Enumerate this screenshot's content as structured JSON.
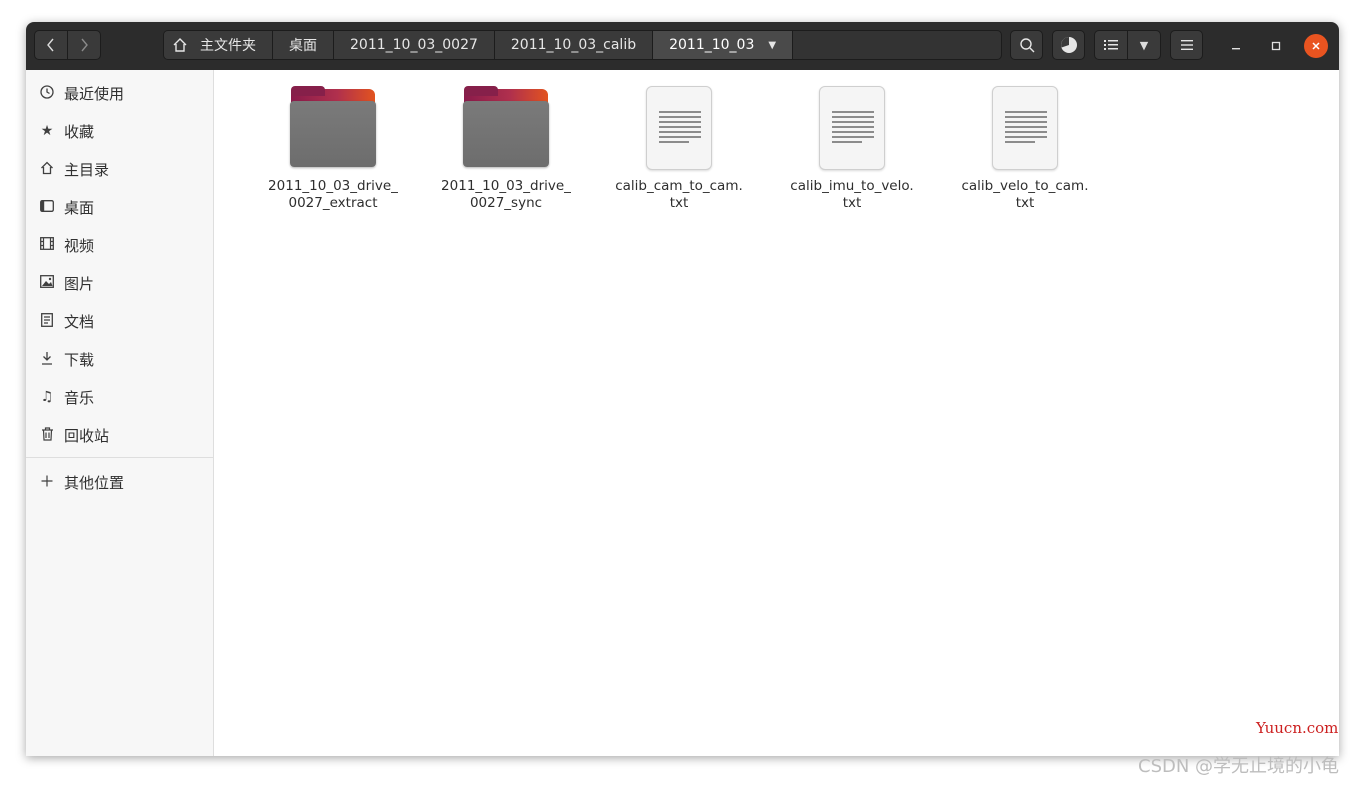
{
  "header": {
    "back_icon": "chevron-left-icon",
    "forward_icon": "chevron-right-icon",
    "breadcrumbs": [
      "主文件夹",
      "桌面",
      "2011_10_03_0027",
      "2011_10_03_calib",
      "2011_10_03"
    ],
    "search_icon": "search-icon",
    "disk_icon": "disk-usage-icon",
    "view_icon": "list-view-icon",
    "view_dropdown_icon": "caret-down-icon",
    "menu_icon": "hamburger-menu-icon",
    "window_controls": [
      "minimize",
      "maximize",
      "close"
    ],
    "close_color": "#e95420"
  },
  "sidebar": {
    "items": [
      {
        "label": "最近使用",
        "icon": "clock-icon"
      },
      {
        "label": "收藏",
        "icon": "star-icon"
      },
      {
        "label": "主目录",
        "icon": "home-icon"
      },
      {
        "label": "桌面",
        "icon": "desktop-icon"
      },
      {
        "label": "视频",
        "icon": "film-icon"
      },
      {
        "label": "图片",
        "icon": "image-icon"
      },
      {
        "label": "文档",
        "icon": "document-icon"
      },
      {
        "label": "下载",
        "icon": "download-icon"
      },
      {
        "label": "音乐",
        "icon": "music-icon"
      },
      {
        "label": "回收站",
        "icon": "trash-icon"
      }
    ],
    "other": {
      "label": "其他位置",
      "icon": "plus-icon"
    }
  },
  "files": [
    {
      "name_line1": "2011_10_03_drive_",
      "name_line2": "0027_extract",
      "type": "folder"
    },
    {
      "name_line1": "2011_10_03_drive_",
      "name_line2": "0027_sync",
      "type": "folder"
    },
    {
      "name_line1": "calib_cam_to_cam.",
      "name_line2": "txt",
      "type": "text"
    },
    {
      "name_line1": "calib_imu_to_velo.",
      "name_line2": "txt",
      "type": "text"
    },
    {
      "name_line1": "calib_velo_to_cam.",
      "name_line2": "txt",
      "type": "text"
    }
  ],
  "watermarks": {
    "site": "Yuucn.com",
    "author": "CSDN @学无止境的小龟"
  }
}
